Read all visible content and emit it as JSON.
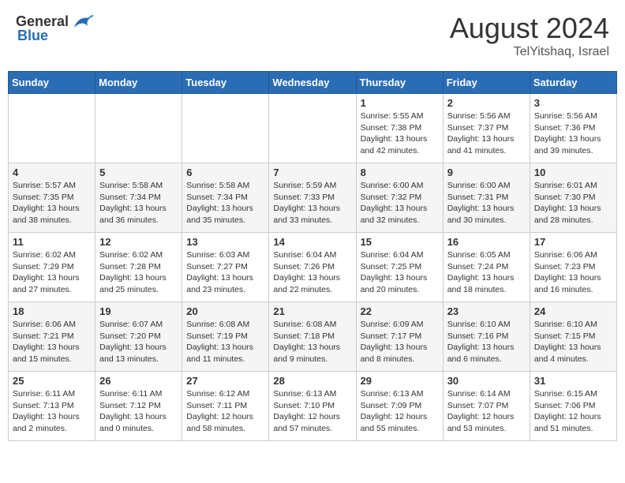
{
  "header": {
    "logo_general": "General",
    "logo_blue": "Blue",
    "month_year": "August 2024",
    "location": "TelYitshaq, Israel"
  },
  "days_of_week": [
    "Sunday",
    "Monday",
    "Tuesday",
    "Wednesday",
    "Thursday",
    "Friday",
    "Saturday"
  ],
  "weeks": [
    [
      {
        "day": "",
        "info": ""
      },
      {
        "day": "",
        "info": ""
      },
      {
        "day": "",
        "info": ""
      },
      {
        "day": "",
        "info": ""
      },
      {
        "day": "1",
        "info": "Sunrise: 5:55 AM\nSunset: 7:38 PM\nDaylight: 13 hours\nand 42 minutes."
      },
      {
        "day": "2",
        "info": "Sunrise: 5:56 AM\nSunset: 7:37 PM\nDaylight: 13 hours\nand 41 minutes."
      },
      {
        "day": "3",
        "info": "Sunrise: 5:56 AM\nSunset: 7:36 PM\nDaylight: 13 hours\nand 39 minutes."
      }
    ],
    [
      {
        "day": "4",
        "info": "Sunrise: 5:57 AM\nSunset: 7:35 PM\nDaylight: 13 hours\nand 38 minutes."
      },
      {
        "day": "5",
        "info": "Sunrise: 5:58 AM\nSunset: 7:34 PM\nDaylight: 13 hours\nand 36 minutes."
      },
      {
        "day": "6",
        "info": "Sunrise: 5:58 AM\nSunset: 7:34 PM\nDaylight: 13 hours\nand 35 minutes."
      },
      {
        "day": "7",
        "info": "Sunrise: 5:59 AM\nSunset: 7:33 PM\nDaylight: 13 hours\nand 33 minutes."
      },
      {
        "day": "8",
        "info": "Sunrise: 6:00 AM\nSunset: 7:32 PM\nDaylight: 13 hours\nand 32 minutes."
      },
      {
        "day": "9",
        "info": "Sunrise: 6:00 AM\nSunset: 7:31 PM\nDaylight: 13 hours\nand 30 minutes."
      },
      {
        "day": "10",
        "info": "Sunrise: 6:01 AM\nSunset: 7:30 PM\nDaylight: 13 hours\nand 28 minutes."
      }
    ],
    [
      {
        "day": "11",
        "info": "Sunrise: 6:02 AM\nSunset: 7:29 PM\nDaylight: 13 hours\nand 27 minutes."
      },
      {
        "day": "12",
        "info": "Sunrise: 6:02 AM\nSunset: 7:28 PM\nDaylight: 13 hours\nand 25 minutes."
      },
      {
        "day": "13",
        "info": "Sunrise: 6:03 AM\nSunset: 7:27 PM\nDaylight: 13 hours\nand 23 minutes."
      },
      {
        "day": "14",
        "info": "Sunrise: 6:04 AM\nSunset: 7:26 PM\nDaylight: 13 hours\nand 22 minutes."
      },
      {
        "day": "15",
        "info": "Sunrise: 6:04 AM\nSunset: 7:25 PM\nDaylight: 13 hours\nand 20 minutes."
      },
      {
        "day": "16",
        "info": "Sunrise: 6:05 AM\nSunset: 7:24 PM\nDaylight: 13 hours\nand 18 minutes."
      },
      {
        "day": "17",
        "info": "Sunrise: 6:06 AM\nSunset: 7:23 PM\nDaylight: 13 hours\nand 16 minutes."
      }
    ],
    [
      {
        "day": "18",
        "info": "Sunrise: 6:06 AM\nSunset: 7:21 PM\nDaylight: 13 hours\nand 15 minutes."
      },
      {
        "day": "19",
        "info": "Sunrise: 6:07 AM\nSunset: 7:20 PM\nDaylight: 13 hours\nand 13 minutes."
      },
      {
        "day": "20",
        "info": "Sunrise: 6:08 AM\nSunset: 7:19 PM\nDaylight: 13 hours\nand 11 minutes."
      },
      {
        "day": "21",
        "info": "Sunrise: 6:08 AM\nSunset: 7:18 PM\nDaylight: 13 hours\nand 9 minutes."
      },
      {
        "day": "22",
        "info": "Sunrise: 6:09 AM\nSunset: 7:17 PM\nDaylight: 13 hours\nand 8 minutes."
      },
      {
        "day": "23",
        "info": "Sunrise: 6:10 AM\nSunset: 7:16 PM\nDaylight: 13 hours\nand 6 minutes."
      },
      {
        "day": "24",
        "info": "Sunrise: 6:10 AM\nSunset: 7:15 PM\nDaylight: 13 hours\nand 4 minutes."
      }
    ],
    [
      {
        "day": "25",
        "info": "Sunrise: 6:11 AM\nSunset: 7:13 PM\nDaylight: 13 hours\nand 2 minutes."
      },
      {
        "day": "26",
        "info": "Sunrise: 6:11 AM\nSunset: 7:12 PM\nDaylight: 13 hours\nand 0 minutes."
      },
      {
        "day": "27",
        "info": "Sunrise: 6:12 AM\nSunset: 7:11 PM\nDaylight: 12 hours\nand 58 minutes."
      },
      {
        "day": "28",
        "info": "Sunrise: 6:13 AM\nSunset: 7:10 PM\nDaylight: 12 hours\nand 57 minutes."
      },
      {
        "day": "29",
        "info": "Sunrise: 6:13 AM\nSunset: 7:09 PM\nDaylight: 12 hours\nand 55 minutes."
      },
      {
        "day": "30",
        "info": "Sunrise: 6:14 AM\nSunset: 7:07 PM\nDaylight: 12 hours\nand 53 minutes."
      },
      {
        "day": "31",
        "info": "Sunrise: 6:15 AM\nSunset: 7:06 PM\nDaylight: 12 hours\nand 51 minutes."
      }
    ]
  ]
}
